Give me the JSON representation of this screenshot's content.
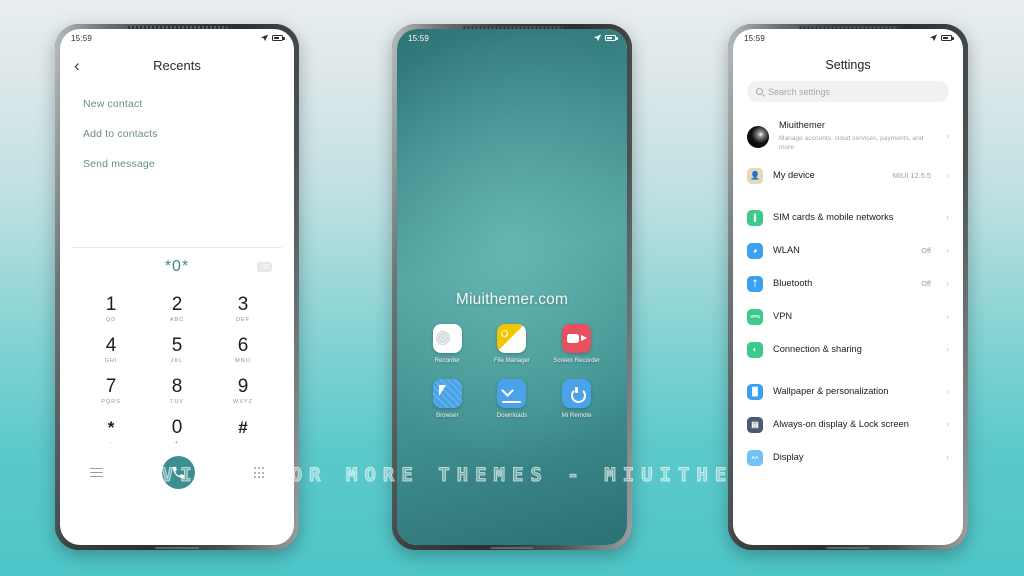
{
  "background": {
    "top_color": "#e9eef0",
    "bottom_color": "#4ec6c9"
  },
  "watermark_strip": {
    "text": "VISIT  FOR  MORE  THEMES  -  MIUITHEMER.COM"
  },
  "phone_dialer": {
    "status": {
      "time": "15:59",
      "icons": [
        "location-arrow-icon",
        "battery-icon"
      ]
    },
    "header": {
      "back_icon": "chevron-left-icon",
      "title": "Recents"
    },
    "links": [
      "New contact",
      "Add to contacts",
      "Send message"
    ],
    "dial_display": {
      "number": "*0*",
      "backspace_icon": "backspace-icon",
      "color": "#3e8b8c"
    },
    "keypad": [
      {
        "digit": "1",
        "sub": "QD"
      },
      {
        "digit": "2",
        "sub": "ABC"
      },
      {
        "digit": "3",
        "sub": "DEF"
      },
      {
        "digit": "4",
        "sub": "GHI"
      },
      {
        "digit": "5",
        "sub": "JKL"
      },
      {
        "digit": "6",
        "sub": "MNO"
      },
      {
        "digit": "7",
        "sub": "PQRS"
      },
      {
        "digit": "8",
        "sub": "TUV"
      },
      {
        "digit": "9",
        "sub": "WXYZ"
      },
      {
        "digit": "*",
        "sub": ","
      },
      {
        "digit": "0",
        "sub": "+"
      },
      {
        "digit": "#",
        "sub": ""
      }
    ],
    "bottom_bar": {
      "menu_icon": "hamburger-menu-icon",
      "call_icon": "phone-call-icon",
      "call_button_color": "#3c8e90",
      "keypad_icon": "dialpad-grid-icon"
    }
  },
  "phone_home": {
    "status": {
      "time": "15:59",
      "icons": [
        "location-arrow-icon",
        "battery-icon"
      ]
    },
    "wallpaper_text": "Miuithemer.com",
    "wallpaper_colors": {
      "light": "#4fa09c",
      "dark": "#2f7377"
    },
    "apps": [
      {
        "label": "Recorder",
        "icon": "recorder-icon",
        "color": "#ffffff"
      },
      {
        "label": "File\nManager",
        "icon": "file-manager-icon",
        "color": "#f4c600"
      },
      {
        "label": "Screen\nRecorder",
        "icon": "screen-recorder-icon",
        "color": "#e8505f"
      },
      {
        "label": "Browser",
        "icon": "browser-icon",
        "color": "#4aa3e8"
      },
      {
        "label": "Downloads",
        "icon": "downloads-icon",
        "color": "#4aa3e8"
      },
      {
        "label": "Mi Remote",
        "icon": "mi-remote-icon",
        "color": "#4aa3e8"
      }
    ]
  },
  "phone_settings": {
    "status": {
      "time": "15:59",
      "icons": [
        "location-arrow-icon",
        "battery-icon"
      ]
    },
    "title": "Settings",
    "search": {
      "placeholder": "Search settings",
      "icon": "search-icon"
    },
    "account": {
      "name": "Miuithemer",
      "subtitle": "Manage accounts, cloud services, payments, and more",
      "avatar": "account-avatar",
      "chevron": "chevron-right-icon"
    },
    "items": [
      {
        "label": "My device",
        "value": "MIUI 12.5.5",
        "icon": "device-icon",
        "color": "#e6d9b8",
        "group": 1
      },
      {
        "label": "SIM cards & mobile networks",
        "value": "",
        "icon": "sim-card-icon",
        "color": "#3ccb8a",
        "group": 2
      },
      {
        "label": "WLAN",
        "value": "Off",
        "icon": "wifi-icon",
        "color": "#3ba0f0",
        "group": 2
      },
      {
        "label": "Bluetooth",
        "value": "Off",
        "icon": "bluetooth-icon",
        "color": "#3ba0f0",
        "group": 2
      },
      {
        "label": "VPN",
        "value": "",
        "icon": "vpn-icon",
        "color": "#3ccb8a",
        "group": 2
      },
      {
        "label": "Connection & sharing",
        "value": "",
        "icon": "connection-sharing-icon",
        "color": "#3ccb8a",
        "group": 2
      },
      {
        "label": "Wallpaper & personalization",
        "value": "",
        "icon": "wallpaper-icon",
        "color": "#3ba0f0",
        "group": 3
      },
      {
        "label": "Always-on display & Lock screen",
        "value": "",
        "icon": "lock-screen-icon",
        "color": "#4a5a72",
        "group": 3
      },
      {
        "label": "Display",
        "value": "",
        "icon": "display-icon",
        "color": "#6fc3f5",
        "group": 3
      }
    ],
    "chevron": "chevron-right-icon"
  }
}
